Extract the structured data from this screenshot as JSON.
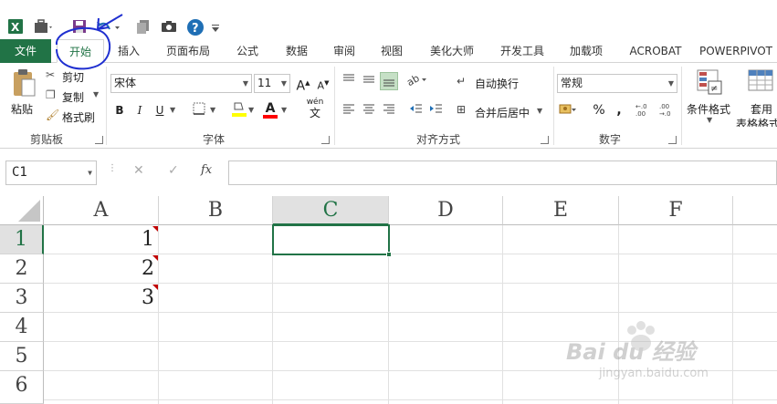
{
  "quick_access": {
    "excel_icon_color": "#217346",
    "items": [
      "excel-icon",
      "briefcase-icon",
      "save-icon",
      "undo-icon",
      "copy-icon",
      "camera-icon",
      "help-icon",
      "customize-icon"
    ]
  },
  "tabs": [
    {
      "label": "文件",
      "kind": "file"
    },
    {
      "label": "开始",
      "kind": "active"
    },
    {
      "label": "插入"
    },
    {
      "label": "页面布局"
    },
    {
      "label": "公式"
    },
    {
      "label": "数据"
    },
    {
      "label": "审阅"
    },
    {
      "label": "视图"
    },
    {
      "label": "美化大师"
    },
    {
      "label": "开发工具"
    },
    {
      "label": "加载项"
    },
    {
      "label": "ACROBAT"
    },
    {
      "label": "POWERPIVOT"
    }
  ],
  "clipboard": {
    "paste": "粘贴",
    "cut": "剪切",
    "copy": "复制",
    "format_painter": "格式刷",
    "group_label": "剪贴板"
  },
  "font": {
    "font_name": "宋体",
    "font_size": "11",
    "grow": "A",
    "shrink": "A",
    "bold": "B",
    "italic": "I",
    "underline": "U",
    "font_color_letter": "A",
    "phonetic": "wén",
    "phonetic_char": "文",
    "group_label": "字体",
    "highlight_color": "#ffff00",
    "font_color": "#ff0000"
  },
  "alignment": {
    "wrap_text": "自动换行",
    "merge_center": "合并后居中",
    "group_label": "对齐方式"
  },
  "number": {
    "format": "常规",
    "percent": "%",
    "comma": ",",
    "group_label": "数字"
  },
  "styles": {
    "conditional": "条件格式",
    "table_format_1": "套用",
    "table_format_2": "表格格式"
  },
  "formula_bar": {
    "name_box": "C1",
    "cancel": "✕",
    "enter": "✓",
    "fx": "fx",
    "formula": ""
  },
  "sheet": {
    "columns": [
      "A",
      "B",
      "C",
      "D",
      "E",
      "F"
    ],
    "selected_column": "C",
    "rows": [
      "1",
      "2",
      "3",
      "4",
      "5",
      "6"
    ],
    "selected_row": "1",
    "cells": [
      {
        "ref": "A1",
        "value": "1"
      },
      {
        "ref": "A2",
        "value": "2"
      },
      {
        "ref": "A3",
        "value": "3"
      }
    ],
    "active_cell": "C1"
  },
  "watermark": {
    "brand": "Bai du 经验",
    "url": "jingyan.baidu.com"
  },
  "annotation_color": "#1f2fd0"
}
